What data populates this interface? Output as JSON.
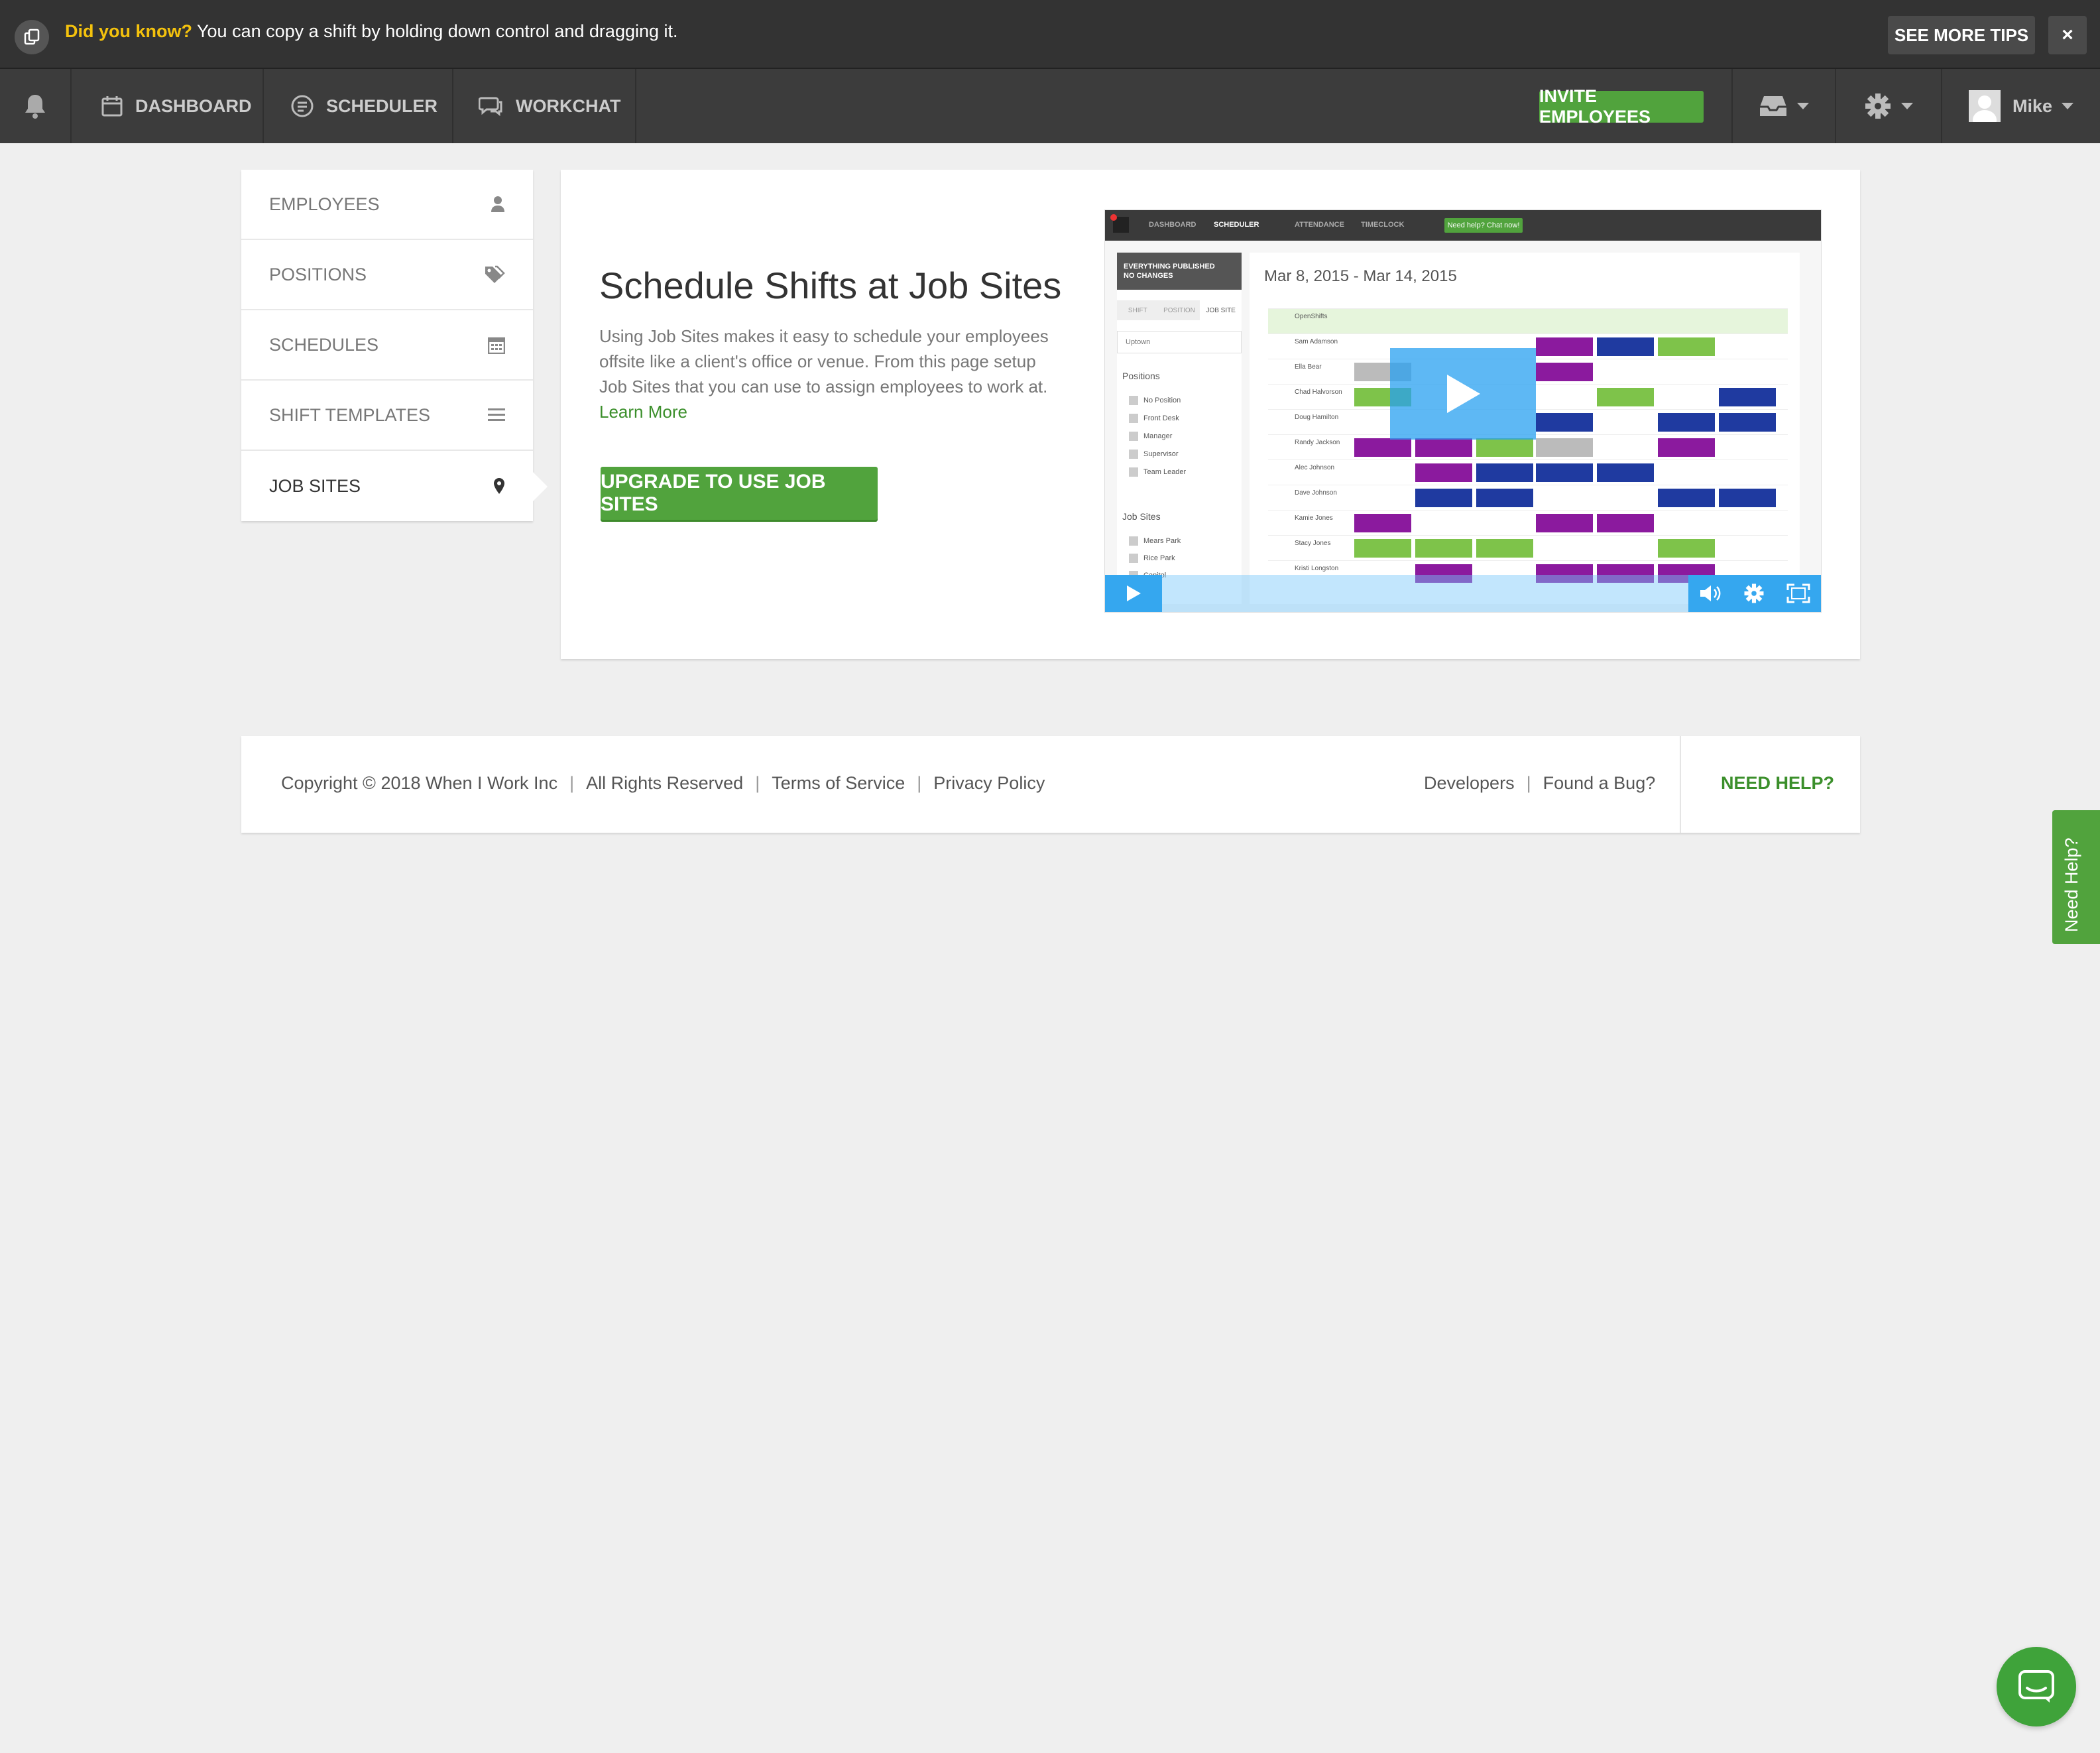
{
  "tipbar": {
    "lead": "Did you know?",
    "text": " You can copy a shift by holding down control and dragging it.",
    "see_more": "SEE MORE TIPS",
    "close": "×"
  },
  "nav": {
    "dashboard": "DASHBOARD",
    "scheduler": "SCHEDULER",
    "workchat": "WORKCHAT",
    "invite": "INVITE EMPLOYEES",
    "user": "Mike"
  },
  "sidebar": {
    "items": [
      {
        "label": "EMPLOYEES",
        "icon": "user-icon"
      },
      {
        "label": "POSITIONS",
        "icon": "tags-icon"
      },
      {
        "label": "SCHEDULES",
        "icon": "calendar-icon"
      },
      {
        "label": "SHIFT TEMPLATES",
        "icon": "list-icon"
      },
      {
        "label": "JOB SITES",
        "icon": "map-marker-icon",
        "active": true
      }
    ]
  },
  "main": {
    "title": "Schedule Shifts at Job Sites",
    "description": "Using Job Sites makes it easy to schedule your employees offsite like a client's office or venue. From this page setup Job Sites that you can use to assign employees to work at.",
    "learn_more": "Learn More",
    "upgrade": "UPGRADE TO USE JOB SITES"
  },
  "video": {
    "tabs": [
      "DASHBOARD",
      "SCHEDULER",
      "ATTENDANCE",
      "TIMECLOCK"
    ],
    "help": "Need help? Chat now!",
    "published": "EVERYTHING PUBLISHED",
    "no_changes": "NO CHANGES",
    "filter_tabs": [
      "SHIFT",
      "POSITION",
      "JOB SITE"
    ],
    "location": "Uptown",
    "positions_header": "Positions",
    "positions": [
      "No Position",
      "Front Desk",
      "Manager",
      "Supervisor",
      "Team Leader"
    ],
    "jobsites_header": "Job Sites",
    "jobsites": [
      "Mears Park",
      "Rice Park",
      "Capitol"
    ],
    "date_range": "Mar 8, 2015 - Mar 14, 2015",
    "staff": [
      "OpenShifts",
      "Sam Adamson",
      "Ella Bear",
      "Chad Halvorson",
      "Doug Hamilton",
      "Randy Jackson",
      "Alec Johnson",
      "Dave Johnson",
      "Kamie Jones",
      "Stacy Jones",
      "Kristi Longston"
    ]
  },
  "footer": {
    "copyright": "Copyright © 2018 When I Work Inc",
    "rights": "All Rights Reserved",
    "terms": "Terms of Service",
    "privacy": "Privacy Policy",
    "developers": "Developers",
    "bug": "Found a Bug?",
    "need_help": "NEED HELP?"
  },
  "side_tab": "Need Help?",
  "colors": {
    "accent": "#51a33d",
    "nav": "#3c3c3c",
    "tip_lead": "#f4c20d"
  }
}
